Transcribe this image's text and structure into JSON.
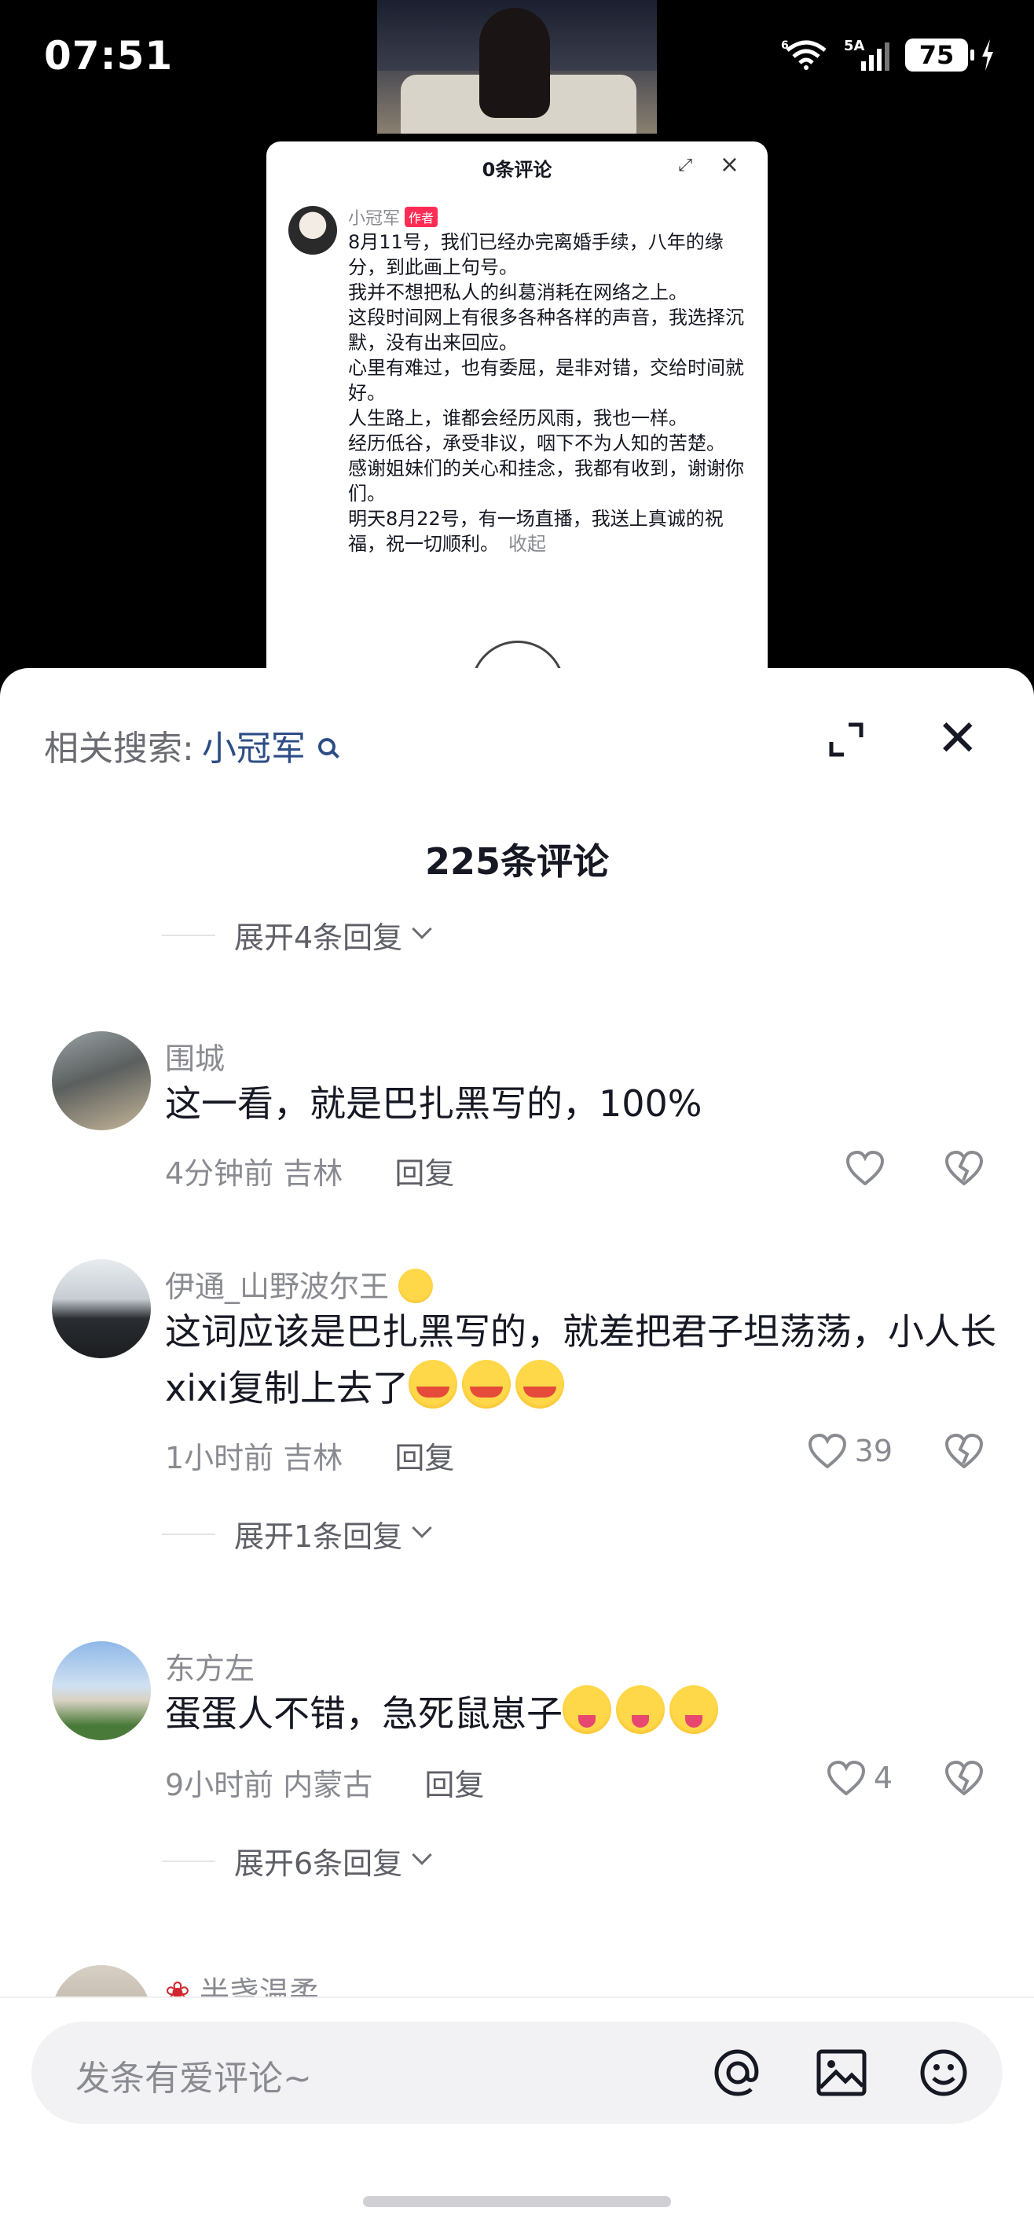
{
  "status_bar": {
    "time": "07:51",
    "network_wifi": "6",
    "network_cell": "5A",
    "battery": "75"
  },
  "inner_card": {
    "title": "0条评论",
    "author_name": "小冠军",
    "author_tag": "作者",
    "paragraphs": [
      "8月11号，我们已经办完离婚手续，八年的缘分，到此画上句号。",
      "我并不想把私人的纠葛消耗在网络之上。",
      "这段时间网上有很多各种各样的声音，我选择沉默，没有出来回应。",
      "心里有难过，也有委屈，是非对错，交给时间就好。",
      "人生路上，谁都会经历风雨，我也一样。",
      "经历低谷，承受非议，咽下不为人知的苦楚。",
      "感谢姐妹们的关心和挂念，我都有收到，谢谢你们。",
      "明天8月22号，有一场直播，我送上真诚的祝福，祝一切顺利。"
    ],
    "collapse_label": "收起"
  },
  "sheet": {
    "related_label": "相关搜索:",
    "related_keyword": "小冠军",
    "comment_count_title": "225条评论",
    "expand_top": "展开4条回复"
  },
  "comments": [
    {
      "name": "围城",
      "text": "这一看，就是巴扎黑写的，100%",
      "time": "4分钟前",
      "location": "吉林",
      "reply": "回复",
      "likes": ""
    },
    {
      "name": "伊通_山野波尔王",
      "text": "这词应该是巴扎黑写的，就差把君子坦荡荡，小人长xixi复制上去了",
      "time": "1小时前",
      "location": "吉林",
      "reply": "回复",
      "likes": "39",
      "expand": "展开1条回复"
    },
    {
      "name": "东方左",
      "text": "蛋蛋人不错，急死鼠崽子",
      "time": "9小时前",
      "location": "内蒙古",
      "reply": "回复",
      "likes": "4",
      "expand": "展开6条回复"
    },
    {
      "name": "半盏温柔"
    }
  ],
  "input": {
    "placeholder": "发条有爱评论~"
  }
}
